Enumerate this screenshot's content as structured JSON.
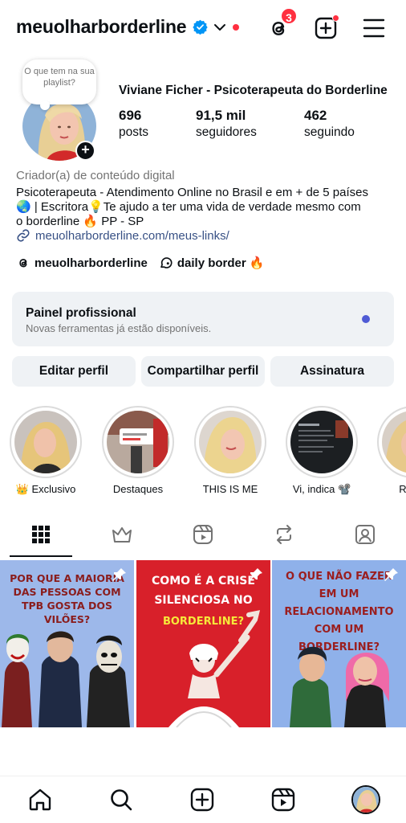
{
  "header": {
    "username": "meuolharborderline",
    "notification_count": "3",
    "icons": [
      "verified-badge",
      "chevron-down",
      "threads",
      "create",
      "menu"
    ]
  },
  "profile": {
    "note": "O que tem na sua playlist?",
    "full_name": "Viviane Ficher - Psicoterapeuta do Borderline",
    "stats": [
      {
        "value": "696",
        "label": "posts"
      },
      {
        "value": "91,5 mil",
        "label": "seguidores"
      },
      {
        "value": "462",
        "label": "seguindo"
      }
    ],
    "category": "Criador(a) de conteúdo digital",
    "bio_lines": [
      "Psicoterapeuta - Atendimento Online no Brasil e em + de 5 países",
      "🌏 | Escritora💡Te ajudo a ter uma vida de verdade mesmo com",
      "o borderline 🔥 PP - SP"
    ],
    "link": "meuolharborderline.com/meus-links/",
    "threads_handle": "meuolharborderline",
    "channel": "daily border 🔥"
  },
  "dashboard": {
    "title": "Painel profissional",
    "subtitle": "Novas ferramentas já estão disponíveis.",
    "dot_color": "#4f5bd5"
  },
  "actions": {
    "edit": "Editar perfil",
    "share": "Compartilhar perfil",
    "subscription": "Assinatura"
  },
  "highlights": [
    {
      "label": "👑 Exclusivo"
    },
    {
      "label": "Destaques"
    },
    {
      "label": "THIS IS ME"
    },
    {
      "label": "Vi, indica 📽️"
    },
    {
      "label": "RESP"
    }
  ],
  "tabs": [
    "grid",
    "subscriptions",
    "reels",
    "reposts",
    "tagged"
  ],
  "posts": [
    {
      "title": "POR QUE A MAIORIA DAS PESSOAS COM TPB GOSTA DOS VILÕES?",
      "bg": "#9db8ea",
      "color": "#8a1d1d"
    },
    {
      "title_top": "COMO É A CRISE SILENCIOSA NO",
      "title_bottom": "BORDERLINE?",
      "bg": "#d8202a",
      "color": "#ffffff",
      "accent": "#f6e93a"
    },
    {
      "title": "O QUE NÃO FAZER EM UM RELACIONAMENTO COM UM BORDERLINE?",
      "bg": "#8fb1ea",
      "color": "#9b1e1e"
    }
  ],
  "bottom_nav": [
    "home",
    "search",
    "create",
    "reels",
    "profile"
  ]
}
